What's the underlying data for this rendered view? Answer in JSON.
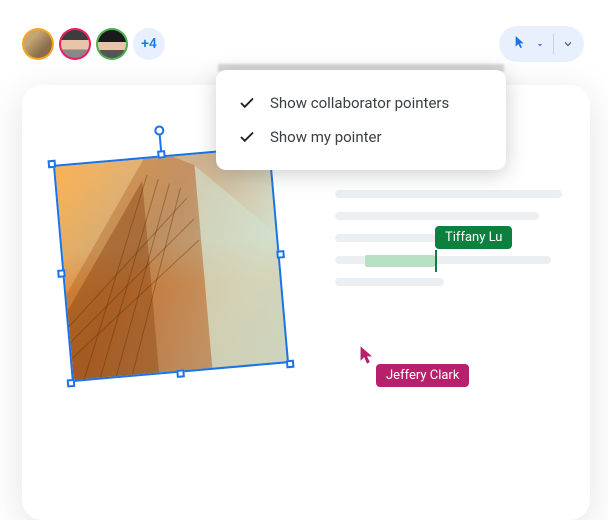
{
  "avatars": {
    "overflow": "+4"
  },
  "dropdown": {
    "item1": "Show collaborator pointers",
    "item2": "Show my pointer"
  },
  "collaborators": {
    "tiffany": "Tiffany Lu",
    "jeffery": "Jeffery Clark"
  },
  "colors": {
    "accent_blue": "#1a73e8",
    "tiffany_green": "#0d7f3e",
    "jeffery_magenta": "#b8206b"
  }
}
